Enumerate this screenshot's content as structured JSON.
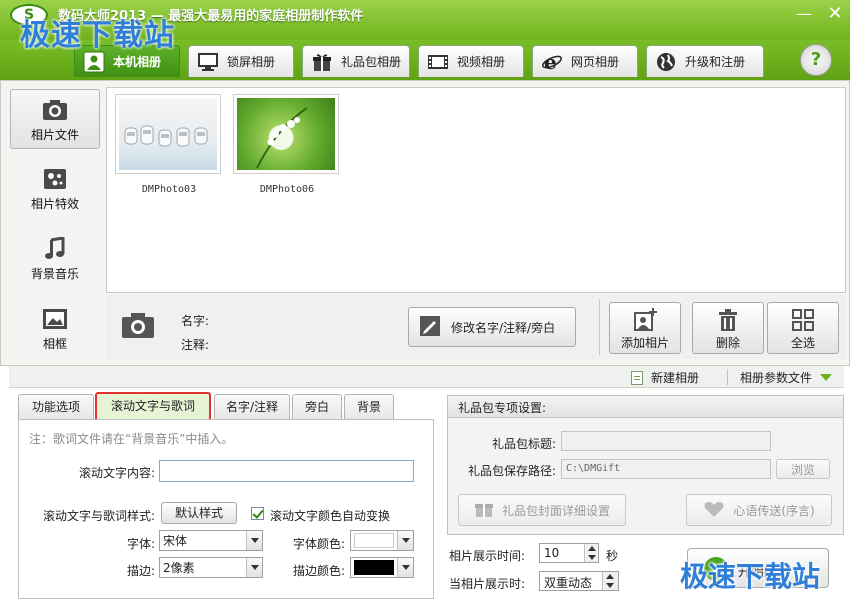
{
  "window": {
    "logo_text": "S",
    "title": "数码大师2013  — 最强大最易用的家庭相册制作软件",
    "watermark": "极速下载站",
    "minimize_glyph": "—",
    "close_glyph": "✕"
  },
  "tabs": [
    {
      "label": "本机相册",
      "icon": "photo-album-icon",
      "active": true
    },
    {
      "label": "锁屏相册",
      "icon": "monitor-icon",
      "active": false
    },
    {
      "label": "礼品包相册",
      "icon": "gift-icon",
      "active": false
    },
    {
      "label": "视频相册",
      "icon": "film-icon",
      "active": false
    },
    {
      "label": "网页相册",
      "icon": "ie-icon",
      "active": false
    },
    {
      "label": "升级和注册",
      "icon": "globe-icon",
      "active": false
    }
  ],
  "help_label": "?",
  "sidebar": {
    "items": [
      {
        "label": "相片文件",
        "icon": "camera-icon",
        "active": true
      },
      {
        "label": "相片特效",
        "icon": "effects-icon",
        "active": false
      },
      {
        "label": "背景音乐",
        "icon": "music-note-icon",
        "active": false
      },
      {
        "label": "相框",
        "icon": "picture-frame-icon",
        "active": false
      }
    ]
  },
  "photos": [
    {
      "name": "DMPhoto03"
    },
    {
      "name": "DMPhoto06"
    }
  ],
  "info": {
    "name_label": "名字:",
    "note_label": "注释:",
    "edit_button": "修改名字/注释/旁白",
    "add_photo": "添加相片",
    "delete": "删除",
    "select_all": "全选"
  },
  "toolbar": {
    "new_album": "新建相册",
    "album_params": "相册参数文件"
  },
  "bottom_tabs": [
    {
      "label": "功能选项",
      "active": false
    },
    {
      "label": "滚动文字与歌词",
      "active": true
    },
    {
      "label": "名字/注释",
      "active": false
    },
    {
      "label": "旁白",
      "active": false
    },
    {
      "label": "背景",
      "active": false
    }
  ],
  "scroll_panel": {
    "note": "注：歌词文件请在“背景音乐”中插入。",
    "content_label": "滚动文字内容:",
    "content_value": "",
    "style_label": "滚动文字与歌词样式:",
    "default_style_button": "默认样式",
    "auto_color_label": "滚动文字颜色自动变换",
    "auto_color_checked": true,
    "font_label": "字体:",
    "font_value": "宋体",
    "font_color_label": "字体颜色:",
    "font_color": "#ffffff",
    "stroke_label": "描边:",
    "stroke_value": "2像素",
    "stroke_color_label": "描边颜色:",
    "stroke_color": "#000000"
  },
  "gift_panel": {
    "header": "礼品包专项设置:",
    "title_label": "礼品包标题:",
    "title_value": "",
    "path_label": "礼品包保存路径:",
    "path_value": "C:\\DMGift",
    "browse_button": "浏览",
    "cover_button": "礼品包封面详细设置",
    "heart_button": "心语传送(序言)"
  },
  "timing": {
    "display_time_label": "相片展示时间:",
    "display_time_value": "10",
    "unit": "秒",
    "current_mode_label": "当相片展示时:",
    "current_mode_value": "双重动态"
  },
  "start_button": "开始播放"
}
